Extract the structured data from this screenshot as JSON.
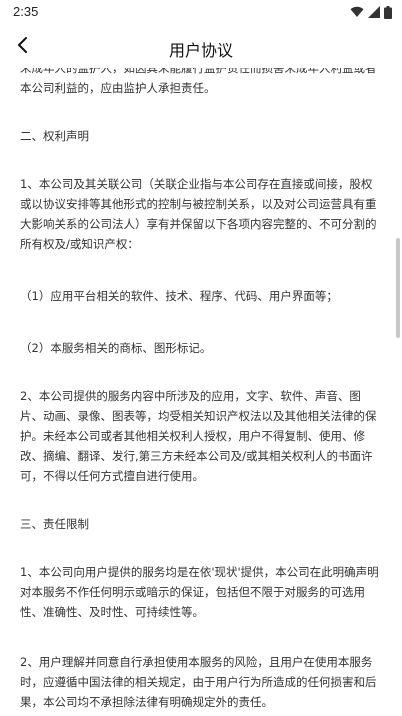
{
  "status_bar": {
    "time": "2:35",
    "icons": [
      "wifi-icon",
      "signal-icon",
      "battery-icon"
    ]
  },
  "nav": {
    "back_icon": "chevron-left-icon",
    "title": "用户协议"
  },
  "content": {
    "paragraphs": [
      "未成年人的监护人，如因其未能履行监护责任而损害未成年人利益或者本公司利益的，应由监护人承担责任。",
      "二、权利声明",
      "1、本公司及其关联公司（关联企业指与本公司存在直接或间接，股权或以协议安排等其他形式的控制与被控制关系，以及对公司运营具有重大影响关系的公司法人）享有并保留以下各项内容完整的、不可分割的所有权及/或知识产权：",
      "（1）应用平台相关的软件、技术、程序、代码、用户界面等；",
      "（2）本服务相关的商标、图形标记。",
      "2、本公司提供的服务内容中所涉及的应用，文字、软件、声音、图片、动画、录像、图表等，均受相关知识产权法以及其他相关法律的保护。未经本公司或者其他相关权利人授权，用户不得复制、使用、修改、摘编、翻译、发行,第三方未经本公司及/或其相关权利人的书面许可，不得以任何方式擅自进行使用。",
      "三、责任限制",
      "1、本公司向用户提供的服务均是在依'现状'提供，本公司在此明确声明对本服务不作任何明示或暗示的保证，包括但不限于对服务的可选用性、准确性、及时性、可持续性等。",
      "2、用户理解并同意自行承担使用本服务的风险，且用户在使用本服务时，应遵循中国法律的相关规定，由于用户行为所造成的任何损害和后果，本公司均不承担除法律有明确规定外的责任。"
    ]
  },
  "colors": {
    "text": "#333333",
    "title": "#111111",
    "background": "#ffffff",
    "scrollbar": "#c8c8c8"
  }
}
